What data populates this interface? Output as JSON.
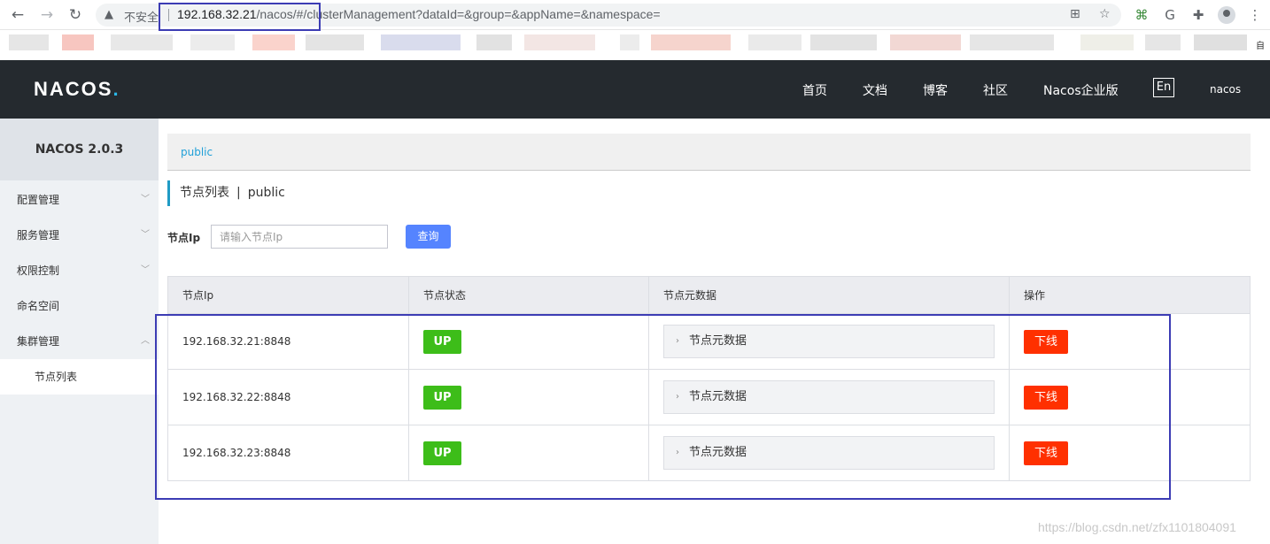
{
  "browser": {
    "insecure_label": "不安全",
    "url_host": "192.168.32.21",
    "url_path": "/nacos/#/clusterManagement?dataId=&group=&appName=&namespace=",
    "bookmark_tail": "自"
  },
  "header": {
    "logo_text": "NACOS",
    "logo_dot": ".",
    "nav": [
      "首页",
      "文档",
      "博客",
      "社区",
      "Nacos企业版"
    ],
    "lang_toggle": "En",
    "user": "nacos"
  },
  "sidebar": {
    "version": "NACOS 2.0.3",
    "items": [
      {
        "label": "配置管理",
        "chevron": "down"
      },
      {
        "label": "服务管理",
        "chevron": "down"
      },
      {
        "label": "权限控制",
        "chevron": "down"
      },
      {
        "label": "命名空间",
        "chevron": ""
      },
      {
        "label": "集群管理",
        "chevron": "up"
      }
    ],
    "sub_items": [
      "节点列表"
    ]
  },
  "main": {
    "namespace": "public",
    "title": "节点列表",
    "title_separator": "|",
    "title_namespace": "public",
    "filter_label": "节点Ip",
    "filter_placeholder": "请输入节点Ip",
    "query_label": "查询",
    "columns": [
      "节点Ip",
      "节点状态",
      "节点元数据",
      "操作"
    ],
    "rows": [
      {
        "ip": "192.168.32.21:8848",
        "state": "UP",
        "metadata": "节点元数据",
        "action": "下线"
      },
      {
        "ip": "192.168.32.22:8848",
        "state": "UP",
        "metadata": "节点元数据",
        "action": "下线"
      },
      {
        "ip": "192.168.32.23:8848",
        "state": "UP",
        "metadata": "节点元数据",
        "action": "下线"
      }
    ]
  },
  "watermark": "https://blog.csdn.net/zfx1101804091",
  "colors": {
    "header_bg": "#252a2f",
    "accent": "#20a0d8",
    "query_button": "#5584ff",
    "up_tag": "#3dbd19",
    "offline_button": "#ff3000",
    "annotation": "#3c3cb4"
  }
}
